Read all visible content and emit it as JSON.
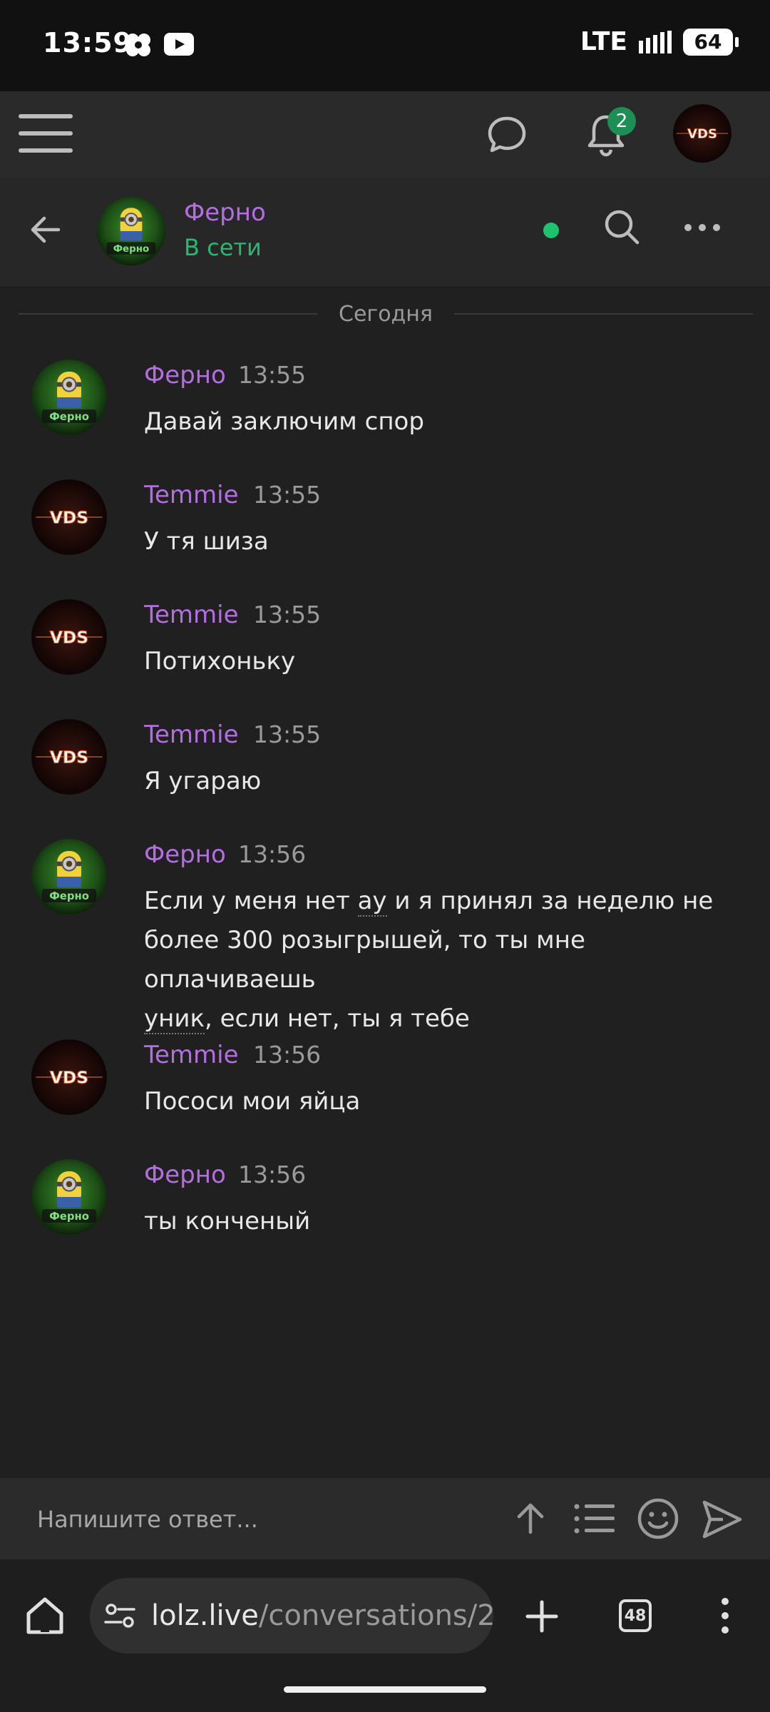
{
  "status_bar": {
    "time": "13:59",
    "network": "LTE",
    "battery": "64"
  },
  "site_header": {
    "notifications_count": "2",
    "icons": [
      "menu-icon",
      "chat-bubble-icon",
      "bell-icon",
      "avatar"
    ]
  },
  "conversation": {
    "name": "Ферно",
    "status": "В сети",
    "status_color": "#29b870",
    "icons": [
      "back-arrow-icon",
      "online-dot",
      "search-icon",
      "more-dots-icon"
    ]
  },
  "date_separator": "Сегодня",
  "messages": [
    {
      "author": "Ферно",
      "time": "13:55",
      "text": "Давай заключим спор",
      "avatar": "ferno"
    },
    {
      "author": "Temmie",
      "time": "13:55",
      "text": "У тя шиза",
      "avatar": "vds"
    },
    {
      "author": "Temmie",
      "time": "13:55",
      "text": "Потихоньку",
      "avatar": "vds"
    },
    {
      "author": "Temmie",
      "time": "13:55",
      "text": "Я угараю",
      "avatar": "vds"
    },
    {
      "author": "Ферно",
      "time": "13:56",
      "avatar": "ferno",
      "line1_a": "Если у меня нет ",
      "line1_term": "ау",
      "line1_b": " и я принял за неделю не",
      "line2": "более 300 розыгрышей, то ты мне оплачиваешь",
      "line3_term": "уник",
      "line3_b": ", если нет, ты я тебе"
    },
    {
      "author": "Temmie",
      "time": "13:56",
      "text": "Пососи мои яйца",
      "avatar": "vds"
    },
    {
      "author": "Ферно",
      "time": "13:56",
      "text": "ты конченый",
      "avatar": "ferno"
    }
  ],
  "avatar_labels": {
    "ferno": "Ферно",
    "vds": "VDS"
  },
  "reply": {
    "placeholder": "Напишите ответ..."
  },
  "browser": {
    "url_host": "lolz.live",
    "url_path": "/conversations/2",
    "tab_count": "48"
  },
  "colors": {
    "author": "#b36ee0",
    "online": "#1fc36e",
    "badge": "#1f8e55"
  }
}
